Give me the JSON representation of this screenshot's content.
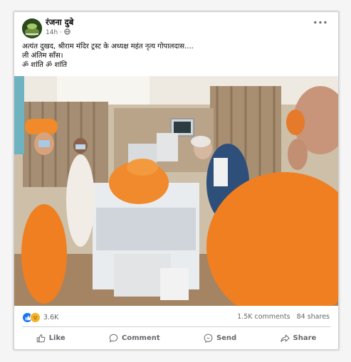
{
  "post": {
    "author": "रंजना दुबे",
    "time": "14h",
    "privacy_icon": "globe-icon",
    "more_icon": "more-options-icon",
    "caption_lines": [
      "अत्यंत दुखद, श्रीराम मंदिर ट्रस्ट के अध्यक्ष महंत नृत्य गोपालदास....",
      "ली अंतिम साँस।",
      "ॐ शांति ॐ शांति"
    ],
    "image_icon": "hospital-photo"
  },
  "stats": {
    "reaction_icons": [
      "like-reaction-icon",
      "sad-reaction-icon"
    ],
    "reactions_count": "3.6K",
    "comments": "1.5K comments",
    "shares": "84 shares"
  },
  "actions": {
    "like_label": "Like",
    "comment_label": "Comment",
    "send_label": "Send",
    "share_label": "Share"
  },
  "colors": {
    "brand_blue": "#1877f2",
    "secondary_text": "#65676b",
    "divider": "#ced0d4"
  }
}
